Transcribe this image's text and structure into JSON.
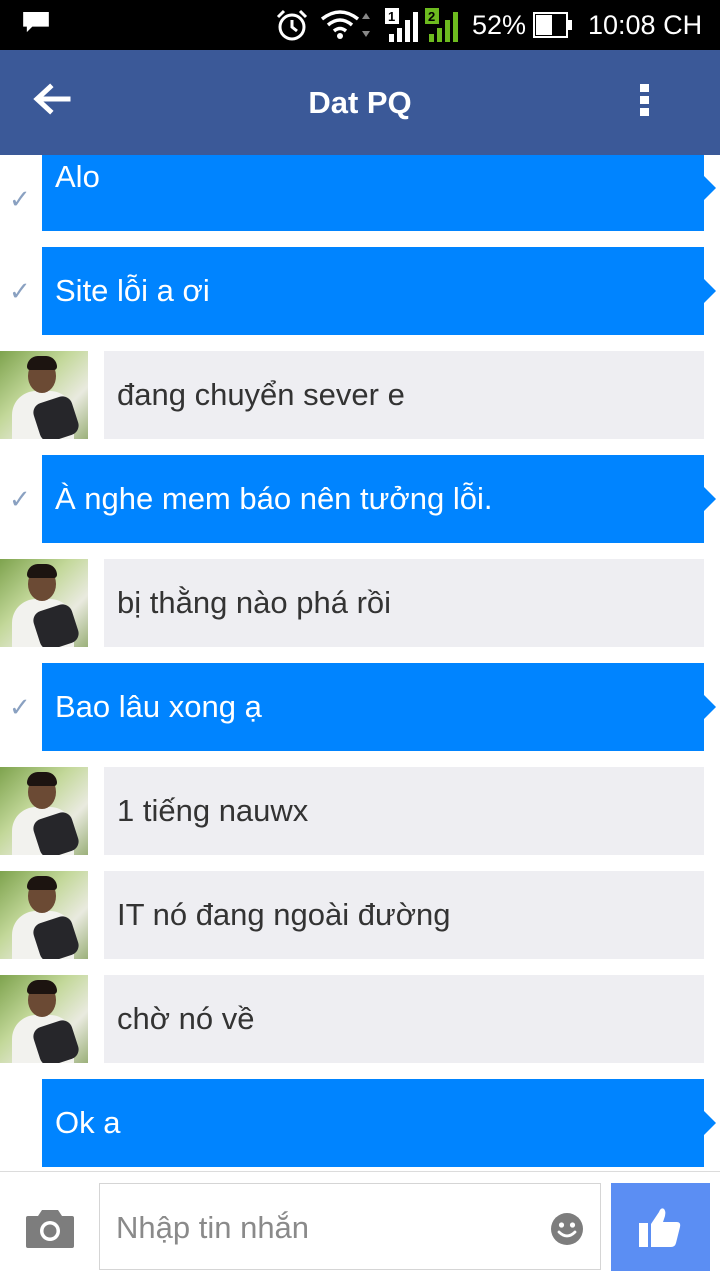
{
  "status_bar": {
    "battery_percent": "52%",
    "time": "10:08 CH",
    "sim1_label": "1",
    "sim2_label": "2",
    "icons": [
      "notification-icon",
      "alarm-icon",
      "wifi-icon",
      "signal-icon",
      "battery-icon"
    ]
  },
  "header": {
    "title": "Dat PQ",
    "back_icon": "arrow-left-icon",
    "menu_icon": "more-vert-icon",
    "color": "#3b5998"
  },
  "messages": [
    {
      "direction": "out",
      "text": "Alo",
      "seen": true
    },
    {
      "direction": "out",
      "text": "Site lỗi a ơi",
      "seen": true
    },
    {
      "direction": "in",
      "text": "đang chuyển sever e"
    },
    {
      "direction": "out",
      "text": "À nghe mem báo nên tưởng lỗi.",
      "seen": true
    },
    {
      "direction": "in",
      "text": "bị thằng nào phá rồi"
    },
    {
      "direction": "out",
      "text": "Bao lâu xong ạ",
      "seen": true
    },
    {
      "direction": "in",
      "text": "1 tiếng nauwx"
    },
    {
      "direction": "in",
      "text": "IT nó đang ngoài đường"
    },
    {
      "direction": "in",
      "text": "chờ nó về"
    },
    {
      "direction": "out",
      "text": "Ok a",
      "seen": false
    }
  ],
  "composer": {
    "placeholder": "Nhập tin nhắn",
    "value": "",
    "camera_icon": "camera-icon",
    "emoji_icon": "smiley-icon",
    "like_icon": "thumbs-up-icon",
    "like_color": "#5b8ef3"
  },
  "colors": {
    "outgoing_bubble": "#0084ff",
    "incoming_bubble": "#eeeef2"
  }
}
